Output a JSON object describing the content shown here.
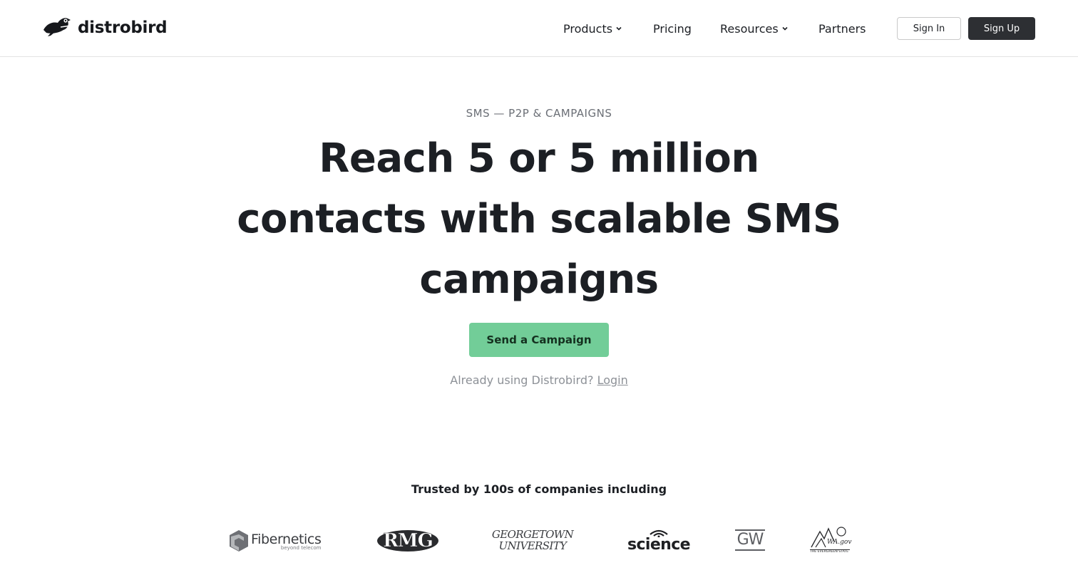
{
  "header": {
    "brand": "distrobird",
    "nav": {
      "products": "Products",
      "pricing": "Pricing",
      "resources": "Resources",
      "partners": "Partners"
    },
    "sign_in": "Sign In",
    "sign_up": "Sign Up"
  },
  "hero": {
    "eyebrow": "SMS — P2P & CAMPAIGNS",
    "headline_lines": [
      "Reach 5 or 5 million",
      "contacts with scalable SMS",
      "campaigns"
    ],
    "cta": "Send a Campaign",
    "already_text": "Already using Distrobird?",
    "login_link": "Login"
  },
  "trusted": {
    "heading": "Trusted by 100s of companies including",
    "logos": {
      "fibernetics": "Fibernetics",
      "fibernetics_tag": "beyond telecom",
      "rmg": "RMG",
      "georgetown_1": "GEORGETOWN",
      "georgetown_2": "UNIVERSITY",
      "science": "science",
      "gw": "GW",
      "wagov": "WA.gov",
      "wagov_tag": "THE EVERGREEN STATE"
    }
  },
  "colors": {
    "cta": "#72cd98",
    "signup_bg": "#2d2f33",
    "text": "#1c1f24",
    "muted": "#8d9197"
  }
}
